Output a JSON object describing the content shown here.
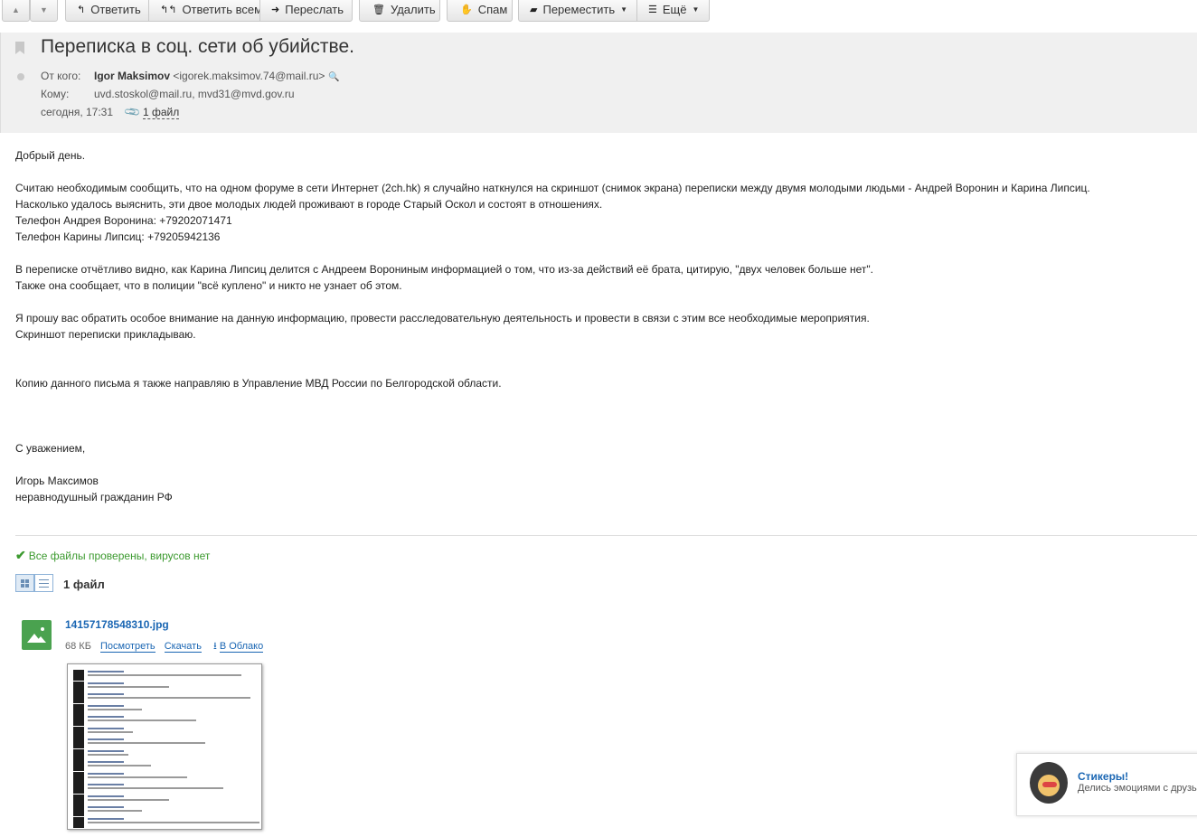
{
  "toolbar": {
    "reply": "Ответить",
    "reply_all": "Ответить всем",
    "forward": "Переслать",
    "delete": "Удалить",
    "spam": "Спам",
    "move": "Переместить",
    "more": "Ещё"
  },
  "message": {
    "subject": "Переписка в соц. сети об убийстве.",
    "from_label": "От кого:",
    "from_name": "Igor Maksimov",
    "from_email": "<igorek.maksimov.74@mail.ru>",
    "to_label": "Кому:",
    "to": "uvd.stoskol@mail.ru, mvd31@mvd.gov.ru",
    "date": "сегодня, 17:31",
    "files_link": "1 файл"
  },
  "body": {
    "greeting": "Добрый день.",
    "p1_l1": "Считаю необходимым сообщить, что на одном форуме в сети Интернет (2ch.hk) я случайно наткнулся на скриншот (снимок экрана) переписки между двумя молодыми людьми - Андрей Воронин и Карина Липсиц.",
    "p1_l2": "Насколько удалось выяснить, эти двое молодых людей проживают в городе Старый Оскол и состоят в отношениях.",
    "p1_l3": "Телефон Андрея Воронина: +79202071471",
    "p1_l4": "Телефон Карины Липсиц: +79205942136",
    "p2_l1": "В переписке отчётливо видно, как Карина Липсиц делится с Андреем Ворониным информацией о том, что из-за действий её брата, цитирую, \"двух человек больше нет\".",
    "p2_l2": "Также она сообщает, что в полиции \"всё куплено\" и никто не узнает об этом.",
    "p3_l1": "Я прошу вас обратить особое внимание на данную информацию, провести расследовательную деятельность и провести в связи с этим все необходимые мероприятия.",
    "p3_l2": "Скриншот переписки прикладываю.",
    "p4": "Копию данного письма я также направляю в Управление МВД России по Белгородской области.",
    "closing": "С уважением,",
    "sig_name": "Игорь Максимов",
    "sig_title": "неравнодушный гражданин РФ"
  },
  "attachments": {
    "virus_check": "Все файлы проверены, вирусов нет",
    "count": "1 файл",
    "file_name": "14157178548310.jpg",
    "file_size": "68 КБ",
    "view": "Посмотреть",
    "download": "Скачать",
    "cloud": "В Облако"
  },
  "stickers": {
    "title": "Стикеры!",
    "subtitle": "Делись эмоциями с друзьями"
  },
  "colors": {
    "link": "#1a66b3",
    "ok_green": "#3c9a2f",
    "header_bg": "#f0f0f0"
  }
}
